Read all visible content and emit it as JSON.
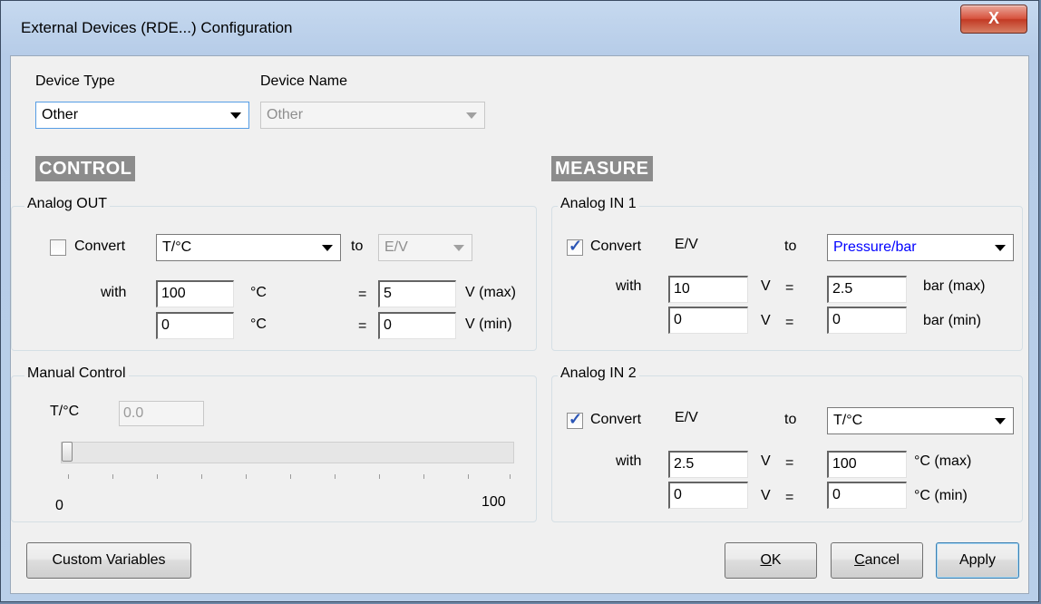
{
  "window": {
    "title": "External Devices (RDE...) Configuration",
    "close_glyph": "X"
  },
  "device": {
    "type_label": "Device Type",
    "type_value": "Other",
    "name_label": "Device Name",
    "name_value": "Other"
  },
  "control": {
    "header": "CONTROL",
    "analog_out": {
      "title": "Analog OUT",
      "convert_label": "Convert",
      "convert_checked": false,
      "from_value": "T/°C",
      "to_label": "to",
      "to_value": "E/V",
      "with_label": "with",
      "max_value": "100",
      "max_unit": "°C",
      "max_eq": "=",
      "max_target": "5",
      "max_suffix": "V (max)",
      "min_value": "0",
      "min_unit": "°C",
      "min_eq": "=",
      "min_target": "0",
      "min_suffix": "V (min)"
    },
    "manual": {
      "title": "Manual Control",
      "var_label": "T/°C",
      "value": "0.0",
      "slider_min": "0",
      "slider_max": "100",
      "slider_position": 0
    }
  },
  "measure": {
    "header": "MEASURE",
    "in1": {
      "title": "Analog IN 1",
      "convert_label": "Convert",
      "convert_checked": true,
      "from_label": "E/V",
      "to_label": "to",
      "to_value": "Pressure/bar",
      "with_label": "with",
      "max_value": "10",
      "max_unit": "V",
      "max_eq": "=",
      "max_target": "2.5",
      "max_suffix": "bar (max)",
      "min_value": "0",
      "min_unit": "V",
      "min_eq": "=",
      "min_target": "0",
      "min_suffix": "bar (min)"
    },
    "in2": {
      "title": "Analog IN 2",
      "convert_label": "Convert",
      "convert_checked": true,
      "from_label": "E/V",
      "to_label": "to",
      "to_value": "T/°C",
      "with_label": "with",
      "max_value": "2.5",
      "max_unit": "V",
      "max_eq": "=",
      "max_target": "100",
      "max_suffix": "°C (max)",
      "min_value": "0",
      "min_unit": "V",
      "min_eq": "=",
      "min_target": "0",
      "min_suffix": "°C (min)"
    }
  },
  "buttons": {
    "custom_variables": "Custom Variables",
    "ok_mnemonic": "O",
    "ok_rest": "K",
    "cancel_mnemonic": "C",
    "cancel_rest": "ancel",
    "apply": "Apply"
  },
  "colors": {
    "accent_text": "#0000ff",
    "section_header_bg": "#8c8c8c",
    "close_button": "#c23a24"
  }
}
